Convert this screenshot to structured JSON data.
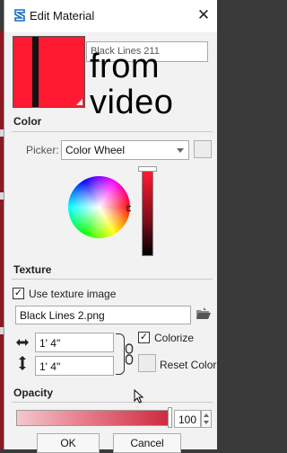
{
  "window": {
    "title": "Edit Material",
    "close_symbol": "✕"
  },
  "material": {
    "name": "Black Lines 211",
    "swatch_color": "#ff1a31",
    "stripe_color": "#121212"
  },
  "overlay": {
    "line1": "from",
    "line2": "video"
  },
  "color_section": {
    "heading": "Color",
    "picker_label": "Picker:",
    "picker_value": "Color Wheel"
  },
  "texture_section": {
    "heading": "Texture",
    "use_texture_label": "Use texture image",
    "use_texture_checked": true,
    "check_glyph": "✓",
    "file_name": "Black Lines 2.png",
    "width": "1' 4\"",
    "height": "1' 4\"",
    "colorize_label": "Colorize",
    "colorize_checked": true,
    "reset_label": "Reset Color"
  },
  "opacity_section": {
    "heading": "Opacity",
    "value": "100",
    "level_percent": 100
  },
  "buttons": {
    "ok": "OK",
    "cancel": "Cancel"
  },
  "icons": {
    "app": "sketchup-logo-icon",
    "folder": "folder-open-icon",
    "width_arrow": "horizontal-arrows-icon",
    "height_arrow": "vertical-arrows-icon",
    "chain": "chain-link-icon",
    "cursor": "mouse-cursor-icon"
  }
}
